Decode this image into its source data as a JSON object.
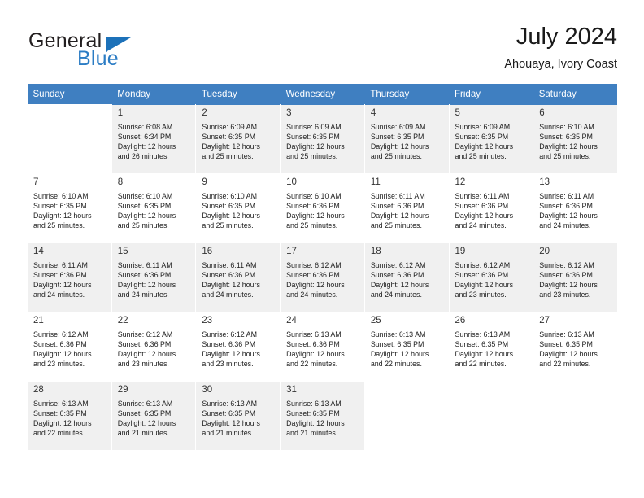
{
  "brand": {
    "name_part1": "General",
    "name_part2": "Blue",
    "triangle_icon": "triangle-icon",
    "accent_dark": "#231f20",
    "accent_blue": "#2b7cc4"
  },
  "header": {
    "title": "July 2024",
    "subtitle": "Ahouaya, Ivory Coast"
  },
  "calendar": {
    "header_bg": "#3f7fc1",
    "band_bg": "#f0f0f0",
    "weekday_headers": [
      "Sunday",
      "Monday",
      "Tuesday",
      "Wednesday",
      "Thursday",
      "Friday",
      "Saturday"
    ],
    "weeks": [
      {
        "band": true,
        "days": [
          {
            "num": "",
            "empty": true,
            "sunrise": "",
            "sunset": "",
            "daylight_1": "",
            "daylight_2": ""
          },
          {
            "num": "1",
            "empty": false,
            "sunrise": "Sunrise: 6:08 AM",
            "sunset": "Sunset: 6:34 PM",
            "daylight_1": "Daylight: 12 hours",
            "daylight_2": "and 26 minutes."
          },
          {
            "num": "2",
            "empty": false,
            "sunrise": "Sunrise: 6:09 AM",
            "sunset": "Sunset: 6:35 PM",
            "daylight_1": "Daylight: 12 hours",
            "daylight_2": "and 25 minutes."
          },
          {
            "num": "3",
            "empty": false,
            "sunrise": "Sunrise: 6:09 AM",
            "sunset": "Sunset: 6:35 PM",
            "daylight_1": "Daylight: 12 hours",
            "daylight_2": "and 25 minutes."
          },
          {
            "num": "4",
            "empty": false,
            "sunrise": "Sunrise: 6:09 AM",
            "sunset": "Sunset: 6:35 PM",
            "daylight_1": "Daylight: 12 hours",
            "daylight_2": "and 25 minutes."
          },
          {
            "num": "5",
            "empty": false,
            "sunrise": "Sunrise: 6:09 AM",
            "sunset": "Sunset: 6:35 PM",
            "daylight_1": "Daylight: 12 hours",
            "daylight_2": "and 25 minutes."
          },
          {
            "num": "6",
            "empty": false,
            "sunrise": "Sunrise: 6:10 AM",
            "sunset": "Sunset: 6:35 PM",
            "daylight_1": "Daylight: 12 hours",
            "daylight_2": "and 25 minutes."
          }
        ]
      },
      {
        "band": false,
        "days": [
          {
            "num": "7",
            "empty": false,
            "sunrise": "Sunrise: 6:10 AM",
            "sunset": "Sunset: 6:35 PM",
            "daylight_1": "Daylight: 12 hours",
            "daylight_2": "and 25 minutes."
          },
          {
            "num": "8",
            "empty": false,
            "sunrise": "Sunrise: 6:10 AM",
            "sunset": "Sunset: 6:35 PM",
            "daylight_1": "Daylight: 12 hours",
            "daylight_2": "and 25 minutes."
          },
          {
            "num": "9",
            "empty": false,
            "sunrise": "Sunrise: 6:10 AM",
            "sunset": "Sunset: 6:35 PM",
            "daylight_1": "Daylight: 12 hours",
            "daylight_2": "and 25 minutes."
          },
          {
            "num": "10",
            "empty": false,
            "sunrise": "Sunrise: 6:10 AM",
            "sunset": "Sunset: 6:36 PM",
            "daylight_1": "Daylight: 12 hours",
            "daylight_2": "and 25 minutes."
          },
          {
            "num": "11",
            "empty": false,
            "sunrise": "Sunrise: 6:11 AM",
            "sunset": "Sunset: 6:36 PM",
            "daylight_1": "Daylight: 12 hours",
            "daylight_2": "and 25 minutes."
          },
          {
            "num": "12",
            "empty": false,
            "sunrise": "Sunrise: 6:11 AM",
            "sunset": "Sunset: 6:36 PM",
            "daylight_1": "Daylight: 12 hours",
            "daylight_2": "and 24 minutes."
          },
          {
            "num": "13",
            "empty": false,
            "sunrise": "Sunrise: 6:11 AM",
            "sunset": "Sunset: 6:36 PM",
            "daylight_1": "Daylight: 12 hours",
            "daylight_2": "and 24 minutes."
          }
        ]
      },
      {
        "band": true,
        "days": [
          {
            "num": "14",
            "empty": false,
            "sunrise": "Sunrise: 6:11 AM",
            "sunset": "Sunset: 6:36 PM",
            "daylight_1": "Daylight: 12 hours",
            "daylight_2": "and 24 minutes."
          },
          {
            "num": "15",
            "empty": false,
            "sunrise": "Sunrise: 6:11 AM",
            "sunset": "Sunset: 6:36 PM",
            "daylight_1": "Daylight: 12 hours",
            "daylight_2": "and 24 minutes."
          },
          {
            "num": "16",
            "empty": false,
            "sunrise": "Sunrise: 6:11 AM",
            "sunset": "Sunset: 6:36 PM",
            "daylight_1": "Daylight: 12 hours",
            "daylight_2": "and 24 minutes."
          },
          {
            "num": "17",
            "empty": false,
            "sunrise": "Sunrise: 6:12 AM",
            "sunset": "Sunset: 6:36 PM",
            "daylight_1": "Daylight: 12 hours",
            "daylight_2": "and 24 minutes."
          },
          {
            "num": "18",
            "empty": false,
            "sunrise": "Sunrise: 6:12 AM",
            "sunset": "Sunset: 6:36 PM",
            "daylight_1": "Daylight: 12 hours",
            "daylight_2": "and 24 minutes."
          },
          {
            "num": "19",
            "empty": false,
            "sunrise": "Sunrise: 6:12 AM",
            "sunset": "Sunset: 6:36 PM",
            "daylight_1": "Daylight: 12 hours",
            "daylight_2": "and 23 minutes."
          },
          {
            "num": "20",
            "empty": false,
            "sunrise": "Sunrise: 6:12 AM",
            "sunset": "Sunset: 6:36 PM",
            "daylight_1": "Daylight: 12 hours",
            "daylight_2": "and 23 minutes."
          }
        ]
      },
      {
        "band": false,
        "days": [
          {
            "num": "21",
            "empty": false,
            "sunrise": "Sunrise: 6:12 AM",
            "sunset": "Sunset: 6:36 PM",
            "daylight_1": "Daylight: 12 hours",
            "daylight_2": "and 23 minutes."
          },
          {
            "num": "22",
            "empty": false,
            "sunrise": "Sunrise: 6:12 AM",
            "sunset": "Sunset: 6:36 PM",
            "daylight_1": "Daylight: 12 hours",
            "daylight_2": "and 23 minutes."
          },
          {
            "num": "23",
            "empty": false,
            "sunrise": "Sunrise: 6:12 AM",
            "sunset": "Sunset: 6:36 PM",
            "daylight_1": "Daylight: 12 hours",
            "daylight_2": "and 23 minutes."
          },
          {
            "num": "24",
            "empty": false,
            "sunrise": "Sunrise: 6:13 AM",
            "sunset": "Sunset: 6:36 PM",
            "daylight_1": "Daylight: 12 hours",
            "daylight_2": "and 22 minutes."
          },
          {
            "num": "25",
            "empty": false,
            "sunrise": "Sunrise: 6:13 AM",
            "sunset": "Sunset: 6:35 PM",
            "daylight_1": "Daylight: 12 hours",
            "daylight_2": "and 22 minutes."
          },
          {
            "num": "26",
            "empty": false,
            "sunrise": "Sunrise: 6:13 AM",
            "sunset": "Sunset: 6:35 PM",
            "daylight_1": "Daylight: 12 hours",
            "daylight_2": "and 22 minutes."
          },
          {
            "num": "27",
            "empty": false,
            "sunrise": "Sunrise: 6:13 AM",
            "sunset": "Sunset: 6:35 PM",
            "daylight_1": "Daylight: 12 hours",
            "daylight_2": "and 22 minutes."
          }
        ]
      },
      {
        "band": true,
        "days": [
          {
            "num": "28",
            "empty": false,
            "sunrise": "Sunrise: 6:13 AM",
            "sunset": "Sunset: 6:35 PM",
            "daylight_1": "Daylight: 12 hours",
            "daylight_2": "and 22 minutes."
          },
          {
            "num": "29",
            "empty": false,
            "sunrise": "Sunrise: 6:13 AM",
            "sunset": "Sunset: 6:35 PM",
            "daylight_1": "Daylight: 12 hours",
            "daylight_2": "and 21 minutes."
          },
          {
            "num": "30",
            "empty": false,
            "sunrise": "Sunrise: 6:13 AM",
            "sunset": "Sunset: 6:35 PM",
            "daylight_1": "Daylight: 12 hours",
            "daylight_2": "and 21 minutes."
          },
          {
            "num": "31",
            "empty": false,
            "sunrise": "Sunrise: 6:13 AM",
            "sunset": "Sunset: 6:35 PM",
            "daylight_1": "Daylight: 12 hours",
            "daylight_2": "and 21 minutes."
          },
          {
            "num": "",
            "empty": true,
            "sunrise": "",
            "sunset": "",
            "daylight_1": "",
            "daylight_2": ""
          },
          {
            "num": "",
            "empty": true,
            "sunrise": "",
            "sunset": "",
            "daylight_1": "",
            "daylight_2": ""
          },
          {
            "num": "",
            "empty": true,
            "sunrise": "",
            "sunset": "",
            "daylight_1": "",
            "daylight_2": ""
          }
        ]
      }
    ]
  }
}
